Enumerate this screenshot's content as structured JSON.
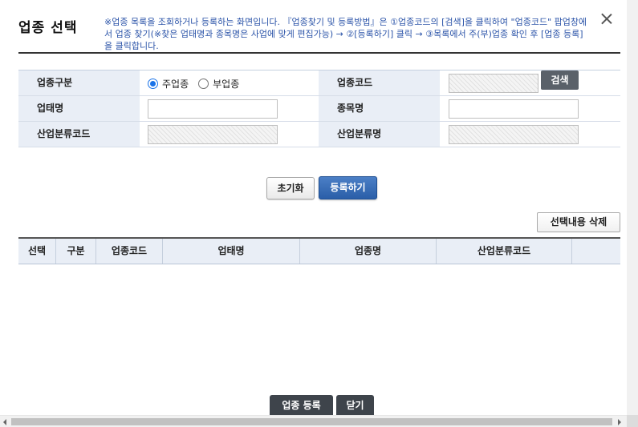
{
  "header": {
    "title": "업종 선택",
    "notice": "※업종 목록을 조회하거나 등록하는 화면입니다. 『업종찾기 및 등록방법』은 ①업종코드의 [검색]을 클릭하여 \"업종코드\" 팝업창에서 업종 찾기(※찾은 업태명과 종목명은 사업에 맞게 편집가능) → ②[등록하기] 클릭 → ③목록에서 주(부)업종 확인 후 [업종 등록]을 클릭합니다."
  },
  "form": {
    "row1": {
      "label_type": "업종구분",
      "radio_primary": "주업종",
      "radio_secondary": "부업종",
      "selected": "주업종",
      "label_code": "업종코드",
      "code_value": "",
      "search_button": "검색"
    },
    "row2": {
      "label_business": "업태명",
      "business_value": "",
      "label_item": "종목명",
      "item_value": ""
    },
    "row3": {
      "label_ind_code": "산업분류코드",
      "ind_code_value": "",
      "label_ind_name": "산업분류명",
      "ind_name_value": ""
    }
  },
  "actions": {
    "reset": "초기화",
    "register": "등록하기",
    "delete_selected": "선택내용 삭제"
  },
  "grid": {
    "columns": [
      "선택",
      "구분",
      "업종코드",
      "업태명",
      "업종명",
      "산업분류코드"
    ],
    "rows": []
  },
  "footer": {
    "register_industry": "업종 등록",
    "close": "닫기"
  }
}
